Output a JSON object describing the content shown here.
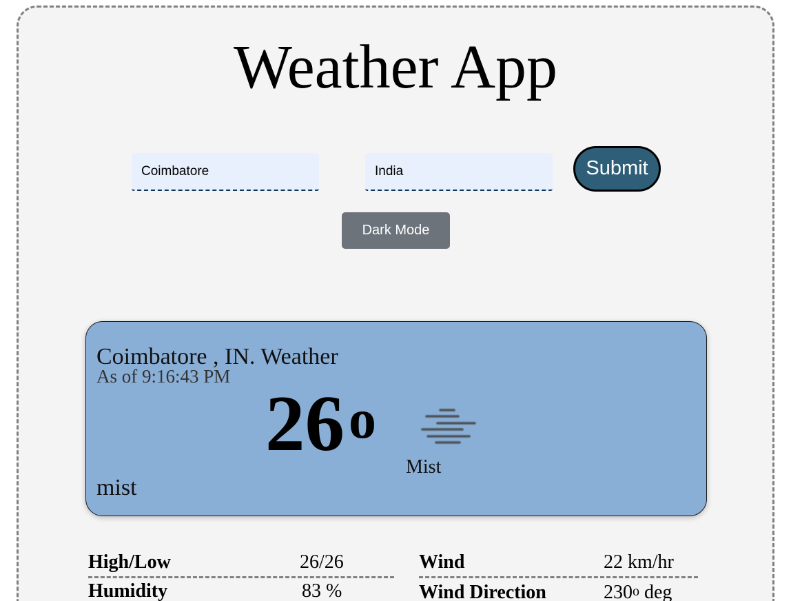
{
  "app": {
    "title": "Weather App"
  },
  "form": {
    "city_value": "Coimbatore",
    "country_value": "India",
    "submit_label": "Submit",
    "dark_mode_label": "Dark Mode"
  },
  "card": {
    "location": "Coimbatore , IN. Weather",
    "as_of": "As of 9:16:43 PM",
    "temperature": "26",
    "degree_symbol": "o",
    "icon_name": "mist-icon",
    "icon_label": "Mist",
    "description": "mist",
    "background_color": "#8aafd7"
  },
  "details": {
    "high_low_label": "High/Low",
    "high_low_value": "26/26",
    "humidity_label": "Humidity",
    "humidity_value": "83 %",
    "wind_label": "Wind",
    "wind_value": "22 km/hr",
    "wind_direction_label": "Wind Direction",
    "wind_direction_value": "230",
    "wind_direction_degree": "o",
    "wind_direction_unit": "deg"
  },
  "colors": {
    "submit_bg": "#2f5f78",
    "dark_mode_bg": "#6c737b",
    "input_bg": "#e8f0fe",
    "page_bg": "#f4f4f4"
  }
}
